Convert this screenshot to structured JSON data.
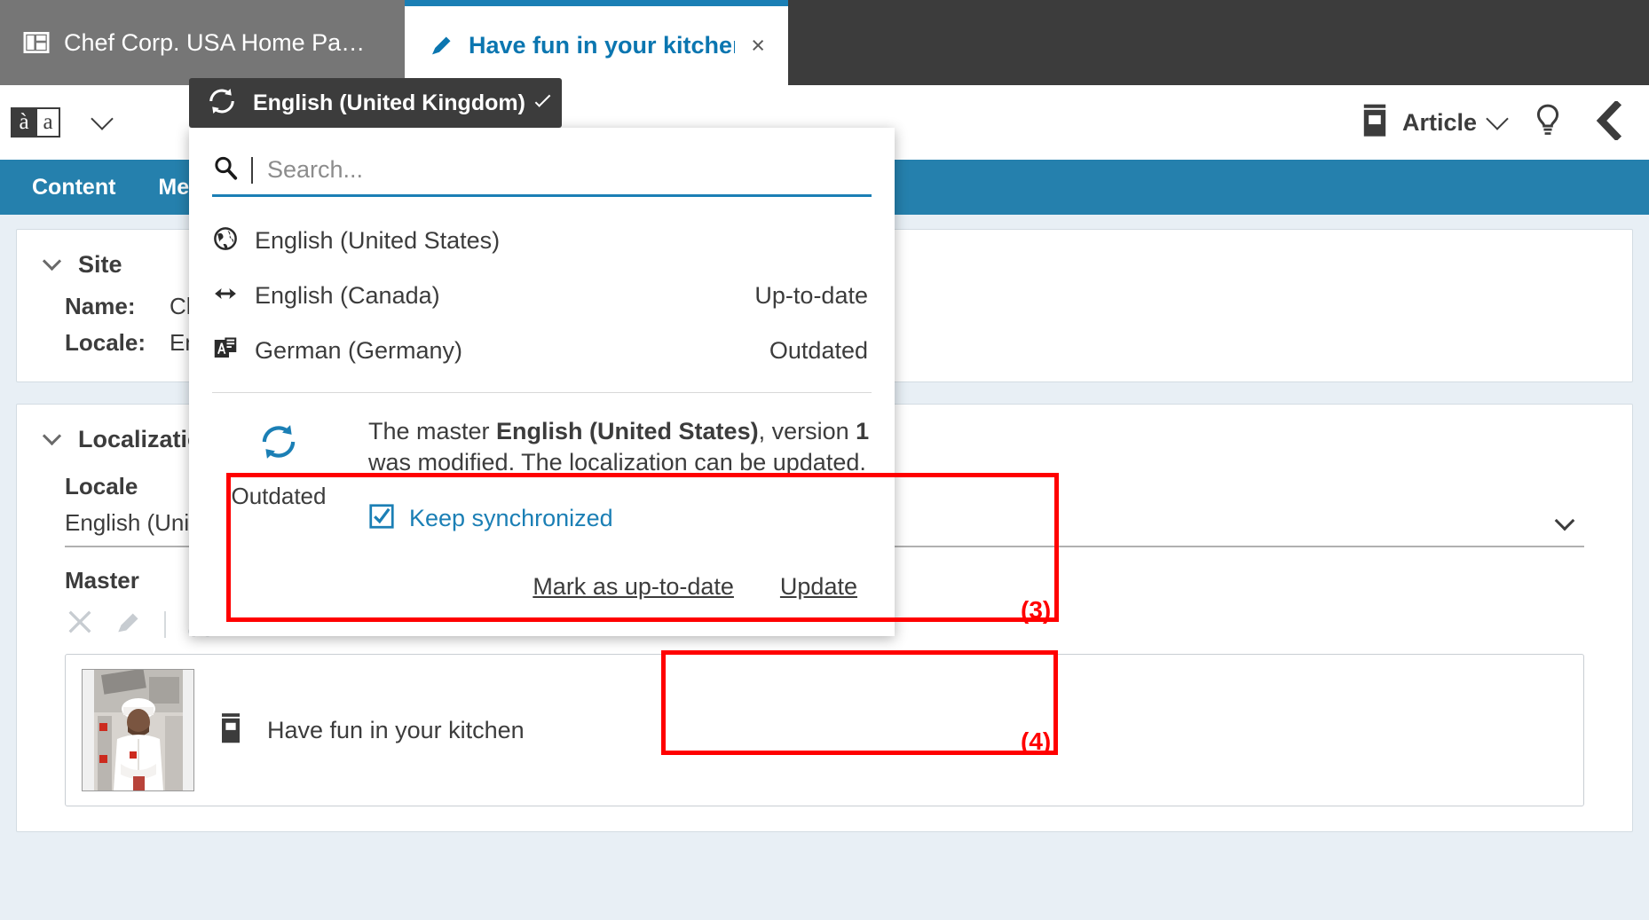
{
  "tabs": [
    {
      "label": "Chef Corp. USA Home Pa…",
      "icon": "page-layout-icon",
      "active": false,
      "closable": false
    },
    {
      "label": "Have fun in your kitchen",
      "icon": "pencil-icon",
      "active": true,
      "closable": true,
      "close_label": "×"
    }
  ],
  "toolbar": {
    "spellcheck_icon": "aa-spellcheck-icon",
    "spellcheck_a1": "à",
    "spellcheck_a2": "a",
    "doctype_label": "Article",
    "doctype_icon": "article-icon",
    "hint_icon": "lightbulb-icon",
    "collapse_icon": "chevron-left-icon"
  },
  "subtabs": [
    {
      "label": "Content"
    },
    {
      "label": "Met"
    }
  ],
  "form": {
    "site_section": {
      "title": "Site",
      "rows": [
        {
          "key": "Name:",
          "value": "Chef"
        },
        {
          "key": "Locale:",
          "value": "Engli"
        }
      ]
    },
    "localization_section": {
      "title": "Localization",
      "locale_label": "Locale",
      "locale_value": "English (Unite",
      "master_label": "Master",
      "master_toolbar": [
        "remove-icon",
        "edit-icon",
        "cut-icon"
      ],
      "master_link": {
        "title": "Have fun in your kitchen",
        "icon": "article-icon",
        "thumbnail": "chef-photo-thumbnail"
      }
    }
  },
  "dropdown": {
    "header": {
      "title": "English (United Kingdom)",
      "icon": "sync-icon",
      "chevron": "chevron-down-icon"
    },
    "search": {
      "placeholder": "Search...",
      "value": "",
      "icon": "search-icon"
    },
    "items": [
      {
        "label": "English (United States)",
        "status": "",
        "icon": "globe-icon"
      },
      {
        "label": "English (Canada)",
        "status": "Up-to-date",
        "icon": "arrows-horizontal-icon"
      },
      {
        "label": "German (Germany)",
        "status": "Outdated",
        "icon": "translate-icon"
      }
    ],
    "info": {
      "status_icon": "sync-icon",
      "status_label": "Outdated",
      "text_parts": {
        "p1": "The master ",
        "b1": "English (United States)",
        "p2": ", version ",
        "b2": "1",
        "p3": " was modified. The localization can be updated."
      },
      "keep_synchronized_label": "Keep synchronized",
      "keep_synchronized_checked": true,
      "checkbox_icon": "checkbox-checked-icon"
    },
    "actions": [
      {
        "label": "Mark as up-to-date"
      },
      {
        "label": "Update"
      }
    ]
  },
  "annotations": [
    {
      "id": "3",
      "label": "(3)"
    },
    {
      "id": "4",
      "label": "(4)"
    }
  ],
  "colors": {
    "tab_active_text": "#0b76b0",
    "tab_inactive_bg": "#767676",
    "chrome_dark": "#3c3c3c",
    "subtab_bar": "#2580ad",
    "accent_blue": "#1b7fb5",
    "form_bg": "#e8eff5",
    "annotation_red": "#ff0000"
  }
}
